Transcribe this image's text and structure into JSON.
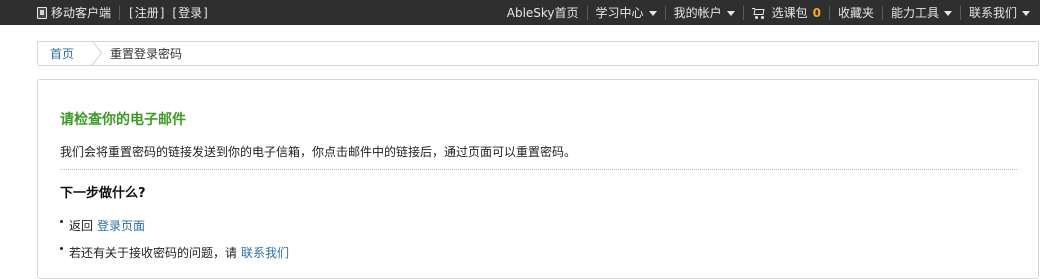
{
  "topbar": {
    "mobile_label": "移动客户端",
    "register_label": "注册",
    "login_label": "登录",
    "home_label": "AbleSky首页",
    "learning_label": "学习中心",
    "account_label": "我的帐户",
    "cart_label": "选课包",
    "cart_count": "0",
    "favorites_label": "收藏夹",
    "tools_label": "能力工具",
    "contact_label": "联系我们"
  },
  "breadcrumb": {
    "home": "首页",
    "current": "重置登录密码"
  },
  "panel": {
    "title": "请检查你的电子邮件",
    "description": "我们会将重置密码的链接发送到你的电子信箱，你点击邮件中的链接后，通过页面可以重置密码。",
    "next_title": "下一步做什么?",
    "tips": [
      {
        "prefix": "返回",
        "link": "登录页面"
      },
      {
        "prefix": "若还有关于接收密码的问题，请",
        "link": "联系我们"
      }
    ]
  },
  "colors": {
    "topbar_bg": "#2f2f2f",
    "title_green": "#3e9b25",
    "link_blue": "#2a6fa8",
    "cart_count": "#f5a623"
  }
}
